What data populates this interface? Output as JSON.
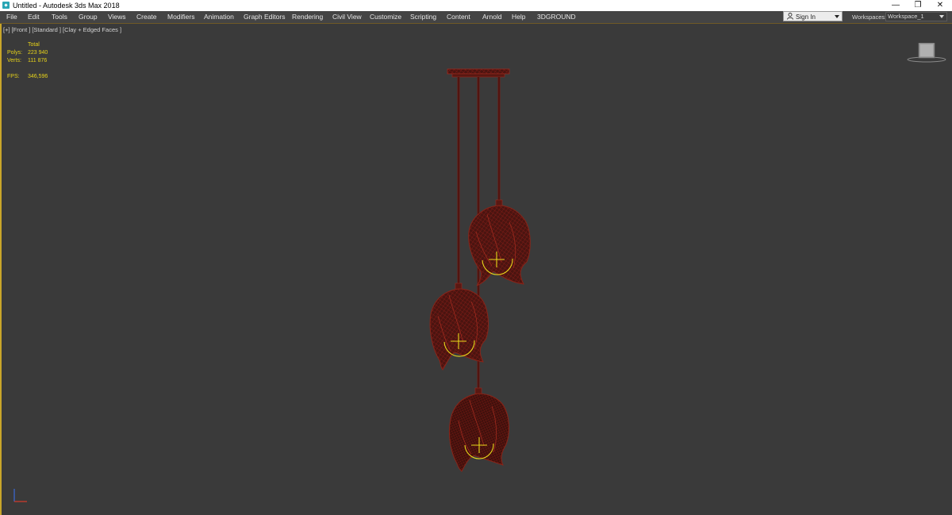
{
  "window": {
    "title": "Untitled - Autodesk 3ds Max 2018",
    "controls": {
      "minimize": "—",
      "restore": "❐",
      "close": "✕"
    }
  },
  "menu": {
    "items": [
      "File",
      "Edit",
      "Tools",
      "Group",
      "Views",
      "Create",
      "Modifiers",
      "Animation",
      "Graph Editors",
      "Rendering",
      "Civil View",
      "Customize",
      "Scripting",
      "Content",
      "Arnold",
      "Help",
      "3DGROUND"
    ]
  },
  "account": {
    "signin_label": "Sign In"
  },
  "workspace": {
    "label": "Workspaces:",
    "value": "Workspace_1"
  },
  "viewport": {
    "labels": [
      "[+]",
      "[Front ]",
      "[Standard ]",
      "[Clay + Edged Faces ]"
    ],
    "stats": {
      "header": "Total",
      "polys_label": "Polys:",
      "polys_value": "223 940",
      "verts_label": "Verts:",
      "verts_value": "111 876",
      "fps_label": "FPS:",
      "fps_value": "346,596"
    },
    "viewcube_face": "front"
  },
  "colors": {
    "viewport_bg": "#3a3a3a",
    "menu_bg": "#444444",
    "active_border": "#c8a52a",
    "stats_text": "#e6d21a",
    "wire": "#7a1a14",
    "light_gizmo": "#e8d81a"
  }
}
